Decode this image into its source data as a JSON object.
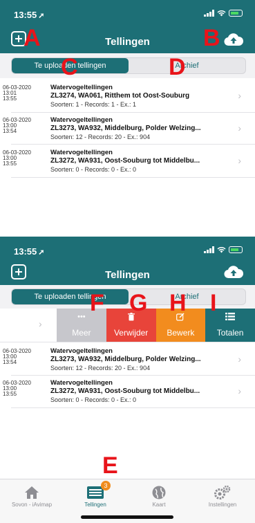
{
  "top_screen": {
    "status_time": "13:55",
    "title": "Tellingen",
    "segments": [
      "Te uploaden tellingen",
      "Archief"
    ],
    "rows": [
      {
        "date": "06-03-2020",
        "time_start": "13:01",
        "time_end": "13:55",
        "project": "Watervogeltellingen",
        "name": "ZL3274, WA061, Ritthem tot Oost-Souburg",
        "meta": "Soorten: 1 - Records: 1 - Ex.: 1"
      },
      {
        "date": "06-03-2020",
        "time_start": "13:00",
        "time_end": "13:54",
        "project": "Watervogeltellingen",
        "name": "ZL3273, WA932, Middelburg, Polder Welzing...",
        "meta": "Soorten: 12 - Records: 20 - Ex.: 904"
      },
      {
        "date": "06-03-2020",
        "time_start": "13:00",
        "time_end": "13:55",
        "project": "Watervogeltellingen",
        "name": "ZL3272, WA931, Oost-Souburg tot Middelbu...",
        "meta": "Soorten: 0 - Records: 0 - Ex.: 0"
      }
    ]
  },
  "bottom_screen": {
    "status_time": "13:55",
    "title": "Tellingen",
    "segments": [
      "Te uploaden tellingen",
      "Archief"
    ],
    "swipe_actions": [
      {
        "label": "Meer",
        "icon": "ellipsis-icon",
        "color": "#c7c7cc"
      },
      {
        "label": "Verwijder",
        "icon": "trash-icon",
        "color": "#e8443a"
      },
      {
        "label": "Bewerk",
        "icon": "edit-icon",
        "color": "#f28c1e"
      },
      {
        "label": "Totalen",
        "icon": "list-icon",
        "color": "#1d6f76"
      }
    ],
    "rows": [
      {
        "date": "06-03-2020",
        "time_start": "13:00",
        "time_end": "13:54",
        "project": "Watervogeltellingen",
        "name": "ZL3273, WA932, Middelburg, Polder Welzing...",
        "meta": "Soorten: 12 - Records: 20 - Ex.: 904"
      },
      {
        "date": "06-03-2020",
        "time_start": "13:00",
        "time_end": "13:55",
        "project": "Watervogeltellingen",
        "name": "ZL3272, WA931, Oost-Souburg tot Middelbu...",
        "meta": "Soorten: 0 - Records: 0 - Ex.: 0"
      }
    ]
  },
  "tabbar": {
    "tabs": [
      {
        "label": "Sovon - iAvimap",
        "icon": "home-icon"
      },
      {
        "label": "Tellingen",
        "icon": "counts-list-icon",
        "badge": "3"
      },
      {
        "label": "Kaart",
        "icon": "globe-icon"
      },
      {
        "label": "Instellingen",
        "icon": "gears-icon"
      }
    ]
  },
  "annotations": [
    "A",
    "B",
    "C",
    "D",
    "E",
    "F",
    "G",
    "H",
    "I"
  ],
  "colors": {
    "accent": "#1d6f76",
    "annotation": "#e8141a"
  }
}
